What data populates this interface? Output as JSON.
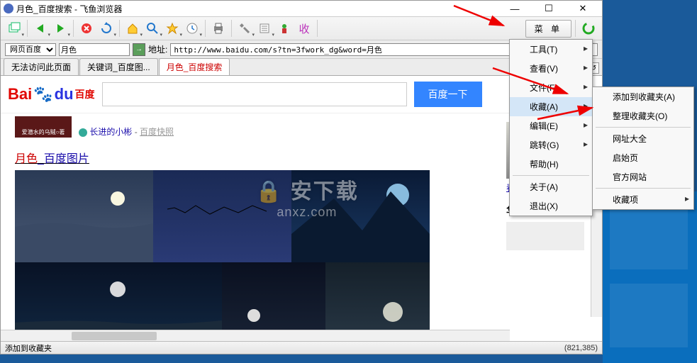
{
  "window": {
    "title": "月色_百度搜索 - 飞鱼浏览器",
    "controls": {
      "min": "—",
      "max": "☐",
      "close": "✕"
    }
  },
  "toolbar_menu_btn": "菜 单",
  "addrbar": {
    "engine_select": "网页百度",
    "keyword": "月色",
    "label": "地址:",
    "url": "http://www.baidu.com/s?tn=3fwork_dg&word=月色"
  },
  "tabs": {
    "t1": "无法访问此页面",
    "t2": "关键词_百度图...",
    "t3": "月色_百度搜索"
  },
  "baidu": {
    "logo_bai": "Bai",
    "logo_du": "du",
    "logo_sub": "百度",
    "search_btn": "百度一下",
    "snippet_thumb": "爱潜水的乌贼○著",
    "snippet_author": "长进的小彬",
    "snippet_dash": " - ",
    "snippet_cache": "百度快照",
    "images_title_red": "月色",
    "images_title_sep": "_",
    "images_title_blue": "百度图片",
    "side_link": "春江花月夜",
    "side_title": "华语音乐"
  },
  "menu": {
    "tools": "工具(T)",
    "view": "查看(V)",
    "file": "文件(F)",
    "fav": "收藏(A)",
    "edit": "编辑(E)",
    "nav": "跳转(G)",
    "help": "帮助(H)",
    "about": "关于(A)",
    "exit": "退出(X)"
  },
  "submenu": {
    "add_fav": "添加到收藏夹(A)",
    "org_fav": "整理收藏夹(O)",
    "url_all": "网址大全",
    "start_page": "启始页",
    "official": "官方网站",
    "fav_items": "收藏项"
  },
  "status": {
    "text": "添加到收藏夹",
    "coord": "(821,385)"
  },
  "watermark": {
    "top": "🔒 安下载",
    "bottom": "anxz.com"
  }
}
